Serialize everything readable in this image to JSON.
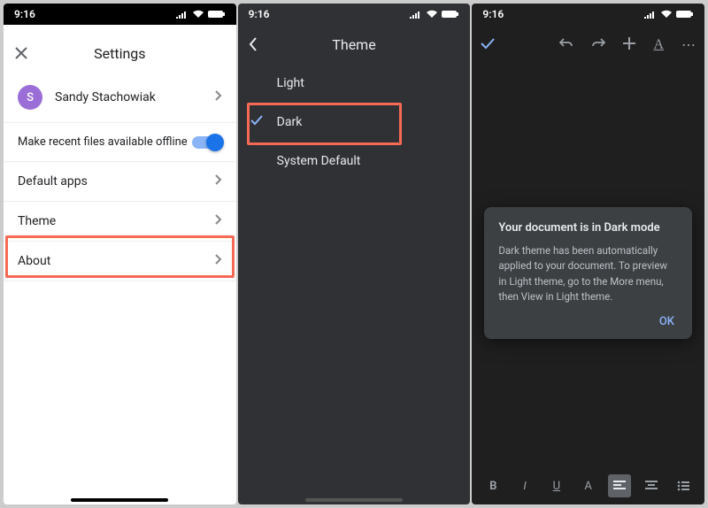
{
  "status": {
    "time": "9:16"
  },
  "settings": {
    "title": "Settings",
    "account": {
      "name": "Sandy Stachowiak",
      "initial": "S"
    },
    "offline_label": "Make recent files available offline",
    "default_apps_label": "Default apps",
    "theme_label": "Theme",
    "about_label": "About"
  },
  "theme": {
    "title": "Theme",
    "options": {
      "light": "Light",
      "dark": "Dark",
      "system": "System Default"
    },
    "selected": "dark"
  },
  "dialog": {
    "title": "Your document is in Dark mode",
    "body": "Dark theme has been automatically applied to your document. To preview in Light theme, go to the More menu, then View in Light theme.",
    "ok": "OK"
  },
  "format": {
    "bold": "B",
    "italic": "I",
    "underline": "U",
    "textcolor": "A"
  }
}
